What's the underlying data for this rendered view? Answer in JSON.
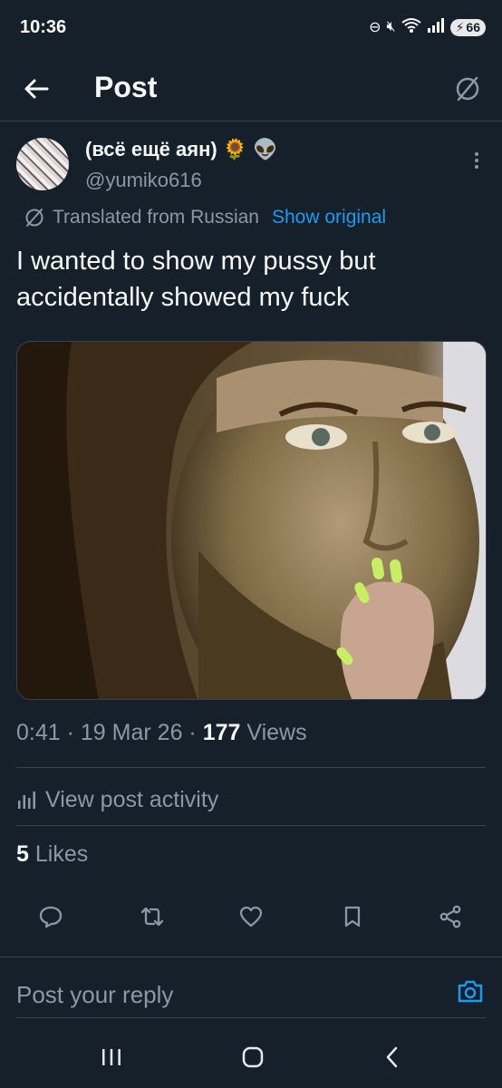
{
  "status_bar": {
    "time": "10:36",
    "battery": "66"
  },
  "header": {
    "title": "Post"
  },
  "post": {
    "author": {
      "display_name": "(всё ещё аян)",
      "emojis": [
        "🌻",
        "👽"
      ],
      "handle": "@yumiko616"
    },
    "translation": {
      "label": "Translated from Russian",
      "link": "Show original"
    },
    "text": "I wanted to show my pussy but accidentally showed my fuck",
    "meta": {
      "time": "0:41",
      "separator": "·",
      "date": "19 Mar 26",
      "views_count": "177",
      "views_label": "Views"
    },
    "activity_label": "View post activity",
    "likes": {
      "count": "5",
      "label": "Likes"
    }
  },
  "reply": {
    "placeholder": "Post your reply"
  },
  "colors": {
    "background": "#15202b",
    "accent": "#1d9bf0",
    "secondary_text": "#8b98a5",
    "primary_text": "#f7f9f9",
    "divider": "#38444d"
  },
  "icons": {
    "back": "arrow-left-icon",
    "translate": "translate-icon",
    "more": "more-vertical-icon",
    "activity": "bar-chart-icon",
    "reply": "reply-icon",
    "repost": "repost-icon",
    "like": "heart-icon",
    "bookmark": "bookmark-icon",
    "share": "share-icon",
    "camera": "camera-icon"
  }
}
